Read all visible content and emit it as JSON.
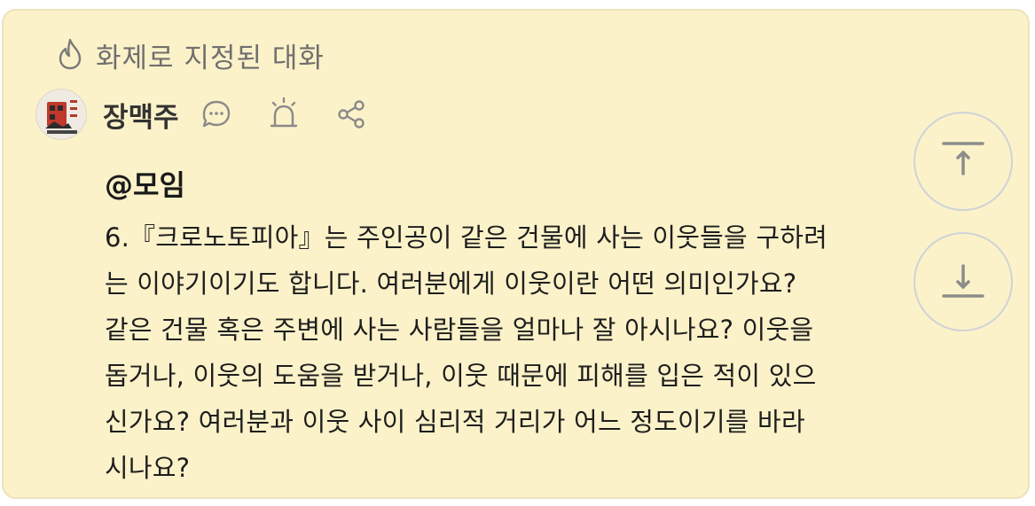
{
  "topic": {
    "icon": "flame-icon",
    "label": "화제로 지정된 대화"
  },
  "author": {
    "name": "장맥주",
    "avatar_icon": "profile-avatar",
    "actions": [
      {
        "name": "comment-icon"
      },
      {
        "name": "alarm-icon"
      },
      {
        "name": "share-icon"
      }
    ]
  },
  "post": {
    "mention": "@모임",
    "body": "6.『크로노토피아』는 주인공이 같은 건물에 사는 이웃들을 구하려\n는 이야기이기도 합니다. 여러분에게 이웃이란 어떤 의미인가요?\n같은 건물 혹은 주변에 사는 사람들을 얼마나 잘 아시나요? 이웃을\n돕거나, 이웃의 도움을 받거나, 이웃 때문에 피해를 입은 적이 있으\n신가요? 여러분과 이웃 사이 심리적 거리가 어느 정도이기를 바라\n시나요?"
  },
  "scroll": {
    "top_icon": "scroll-to-top-icon",
    "bottom_icon": "scroll-to-bottom-icon"
  },
  "colors": {
    "card_background": "#fcf2c9",
    "icon_gray": "#8a8a8a"
  }
}
